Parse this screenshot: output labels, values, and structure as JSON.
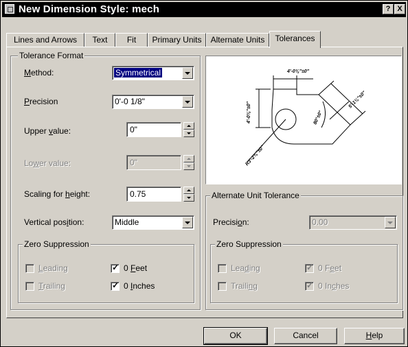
{
  "window": {
    "title": "New Dimension Style: mech",
    "help_glyph": "?",
    "close_glyph": "X"
  },
  "tabs": [
    {
      "label": "Lines and Arrows",
      "active": false
    },
    {
      "label": "Text",
      "active": false
    },
    {
      "label": "Fit",
      "active": false
    },
    {
      "label": "Primary Units",
      "active": false
    },
    {
      "label": "Alternate Units",
      "active": false
    },
    {
      "label": "Tolerances",
      "active": true
    }
  ],
  "tolerance_format": {
    "legend": "Tolerance Format",
    "method": {
      "label_mnemonic": "M",
      "label_rest": "ethod:",
      "value": "Symmetrical"
    },
    "precision": {
      "label_mnemonic": "P",
      "label_rest": "recision",
      "value": "0'-0 1/8\""
    },
    "upper_value": {
      "label_pre": "Upper ",
      "label_mnemonic": "v",
      "label_post": "alue:",
      "value": "0\""
    },
    "lower_value": {
      "label_pre": "Lo",
      "label_mnemonic": "w",
      "label_post": "er value:",
      "value": "0\""
    },
    "scaling": {
      "label_pre": "Scaling for ",
      "label_mnemonic": "h",
      "label_post": "eight:",
      "value": "0.75"
    },
    "vertical_position": {
      "label_pre": "Vertical pos",
      "label_mnemonic": "i",
      "label_post": "tion:",
      "value": "Middle"
    },
    "zero_suppression": {
      "legend": "Zero Suppression",
      "leading": {
        "mnemonic": "L",
        "rest": "eading",
        "checked": false,
        "enabled": false
      },
      "trailing": {
        "mnemonic": "T",
        "rest": "railing",
        "checked": false,
        "enabled": false
      },
      "feet": {
        "pre": "0 ",
        "mnemonic": "F",
        "rest": "eet",
        "checked": true,
        "enabled": true
      },
      "inches": {
        "pre": "0 ",
        "mnemonic": "I",
        "rest": "nches",
        "checked": true,
        "enabled": true
      }
    }
  },
  "preview": {
    "dims": {
      "top": "4'-0⅜\"±0\"",
      "left": "4'-0⅜\"±0\"",
      "right": "5'-1⅛\"±0\"",
      "angle": "80°±0°",
      "radius": "R3'-2⅜\"±0\""
    }
  },
  "alternate_unit_tolerance": {
    "legend": "Alternate Unit Tolerance",
    "precision": {
      "label_pre": "Precisi",
      "label_mnemonic": "o",
      "label_post": "n:",
      "value": "0.00"
    },
    "zero_suppression": {
      "legend": "Zero Suppression",
      "leading": {
        "pre": "Lea",
        "mnemonic": "d",
        "rest": "ing",
        "checked": false,
        "enabled": false
      },
      "trailing": {
        "pre": "Traili",
        "mnemonic": "n",
        "rest": "g",
        "checked": false,
        "enabled": false
      },
      "feet": {
        "pre": "0 F",
        "mnemonic": "e",
        "rest": "et",
        "checked": true,
        "enabled": false
      },
      "inches": {
        "pre": "0 In",
        "mnemonic": "c",
        "rest": "hes",
        "checked": true,
        "enabled": false
      }
    }
  },
  "buttons": {
    "ok": "OK",
    "cancel": "Cancel",
    "help_mnemonic": "H",
    "help_rest": "elp"
  },
  "colors": {
    "face": "#d4d0c8",
    "titlebar": "#000000",
    "selection": "#000080"
  }
}
